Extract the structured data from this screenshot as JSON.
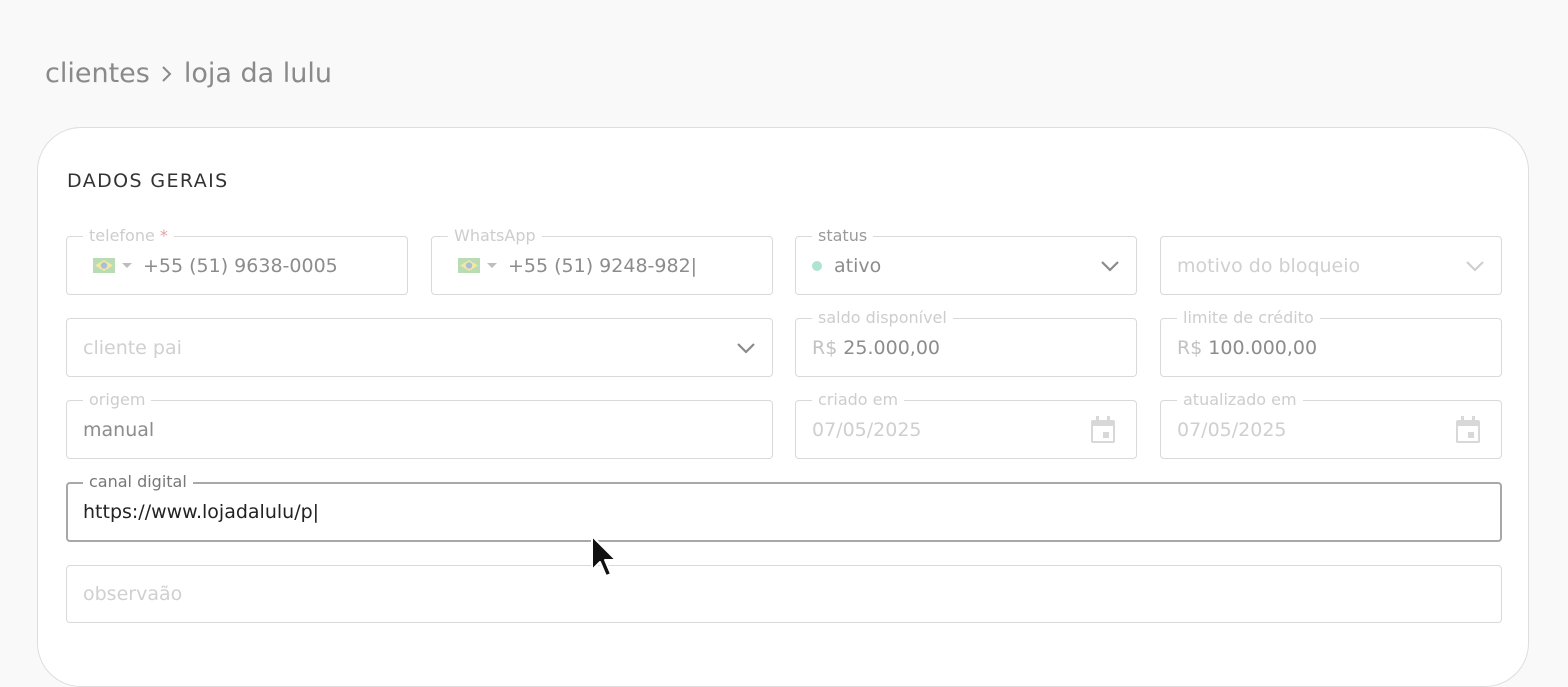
{
  "breadcrumb": {
    "parent": "clientes",
    "current": "loja da lulu"
  },
  "section": {
    "title": "DADOS GERAIS"
  },
  "fields": {
    "telefone": {
      "label": "telefone",
      "required_mark": "*",
      "value": "+55 (51) 9638-0005"
    },
    "whatsapp": {
      "label": "WhatsApp",
      "value": "+55 (51) 9248-982|"
    },
    "status": {
      "label": "status",
      "value": "ativo",
      "dot_color": "#aee5d0"
    },
    "motivo_bloqueio": {
      "placeholder": "motivo do bloqueio"
    },
    "cliente_pai": {
      "placeholder": "cliente pai"
    },
    "saldo_disponivel": {
      "label": "saldo disponível",
      "prefix": "R$",
      "value": "25.000,00"
    },
    "limite_credito": {
      "label": "limite de crédito",
      "prefix": "R$",
      "value": "100.000,00"
    },
    "origem": {
      "label": "origem",
      "value": "manual"
    },
    "criado_em": {
      "label": "criado em",
      "value": "07/05/2025"
    },
    "atualizado_em": {
      "label": "atualizado em",
      "value": "07/05/2025"
    },
    "canal_digital": {
      "label": "canal digital",
      "value": "https://www.lojadalulu/p|"
    },
    "observacao": {
      "placeholder": "observaão"
    }
  },
  "icons": {
    "flag": "brazil-flag-icon",
    "chevron": "chevron-down-icon",
    "calendar": "calendar-icon",
    "cursor": "mouse-cursor-icon"
  }
}
